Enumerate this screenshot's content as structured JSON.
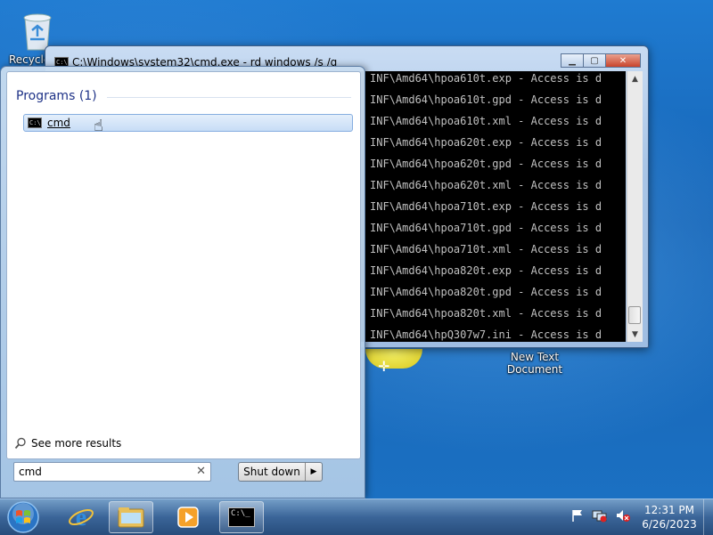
{
  "desktop": {
    "recycle_bin_label": "Recycle",
    "new_text_label": "New Text Document"
  },
  "cmd_window": {
    "title": "C:\\Windows\\system32\\cmd.exe - rd  windows /s /q",
    "lines": [
      "INF\\Amd64\\hpoa610t.exp - Access is d",
      "INF\\Amd64\\hpoa610t.gpd - Access is d",
      "INF\\Amd64\\hpoa610t.xml - Access is d",
      "INF\\Amd64\\hpoa620t.exp - Access is d",
      "INF\\Amd64\\hpoa620t.gpd - Access is d",
      "INF\\Amd64\\hpoa620t.xml - Access is d",
      "INF\\Amd64\\hpoa710t.exp - Access is d",
      "INF\\Amd64\\hpoa710t.gpd - Access is d",
      "INF\\Amd64\\hpoa710t.xml - Access is d",
      "INF\\Amd64\\hpoa820t.exp - Access is d",
      "INF\\Amd64\\hpoa820t.gpd - Access is d",
      "INF\\Amd64\\hpoa820t.xml - Access is d",
      "INF\\Amd64\\hpQ307w7.ini - Access is d"
    ],
    "buttons": {
      "minimize": "▁",
      "maximize": "▢",
      "close": "✕"
    }
  },
  "start_menu": {
    "programs_header": "Programs (1)",
    "results": [
      {
        "label": "cmd"
      }
    ],
    "see_more": "See more results",
    "search_value": "cmd",
    "shutdown_label": "Shut down"
  },
  "taskbar": {
    "time": "12:31 PM",
    "date": "6/26/2023"
  },
  "colors": {
    "desktop_blue": "#1b6fc0",
    "console_bg": "#000000",
    "console_text": "#c0c0c0",
    "programs_header": "#1e3287"
  },
  "icons": [
    "recycle-bin-icon",
    "text-document-icon",
    "cmd-icon",
    "search-icon",
    "windows-orb-icon",
    "internet-explorer-icon",
    "explorer-folder-icon",
    "media-player-icon",
    "flag-icon",
    "network-icon",
    "volume-muted-icon"
  ]
}
